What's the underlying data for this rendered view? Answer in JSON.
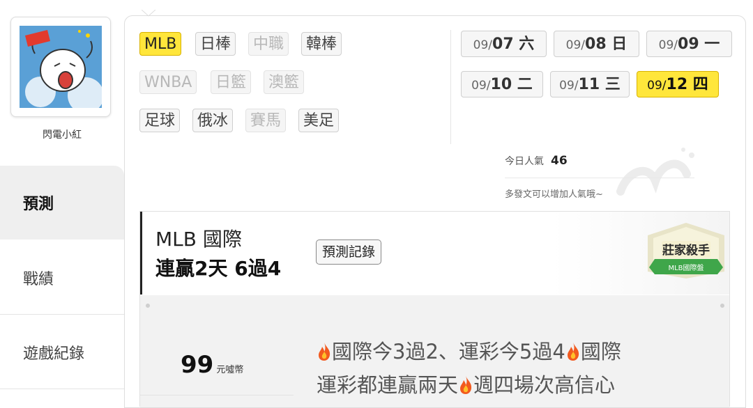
{
  "user": {
    "name": "閃電小紅",
    "avatar_icon": "cartoon-avatar-icon"
  },
  "nav": {
    "predict": "預測",
    "record": "戰績",
    "games": "遊戲紀錄"
  },
  "leagues": [
    {
      "label": "MLB",
      "state": "active"
    },
    {
      "label": "日棒",
      "state": "normal"
    },
    {
      "label": "中職",
      "state": "disabled"
    },
    {
      "label": "韓棒",
      "state": "normal"
    },
    {
      "label": "WNBA",
      "state": "disabled"
    },
    {
      "label": "日籃",
      "state": "disabled"
    },
    {
      "label": "澳籃",
      "state": "disabled"
    },
    {
      "label": "足球",
      "state": "normal"
    },
    {
      "label": "俄冰",
      "state": "normal"
    },
    {
      "label": "賽馬",
      "state": "disabled"
    },
    {
      "label": "美足",
      "state": "normal"
    }
  ],
  "dates": [
    {
      "md": "09/",
      "day": "07 六",
      "active": false
    },
    {
      "md": "09/",
      "day": "08 日",
      "active": false
    },
    {
      "md": "09/",
      "day": "09 一",
      "active": false
    },
    {
      "md": "09/",
      "day": "10 二",
      "active": false
    },
    {
      "md": "09/",
      "day": "11 三",
      "active": false
    },
    {
      "md": "09/",
      "day": "12 四",
      "active": true
    }
  ],
  "popularity": {
    "label": "今日人氣",
    "value": "46",
    "hint": "多發文可以增加人氣哦~"
  },
  "card": {
    "league_title": "MLB 國際",
    "streak": "連贏2天 6過4",
    "history_button": "預測記錄",
    "badge": {
      "line1": "莊家殺手",
      "line2": "MLB國際盤"
    },
    "price": {
      "amount": "99",
      "unit": "元噓幣"
    },
    "desc": {
      "p1": "國際今3過2、運彩今5過4",
      "p2": "國際",
      "p3": "運彩都連贏兩天",
      "p4": "週四場次高信心"
    }
  },
  "colors": {
    "accent_yellow": "#ffe63b",
    "nav_active_bg": "#efefef"
  }
}
